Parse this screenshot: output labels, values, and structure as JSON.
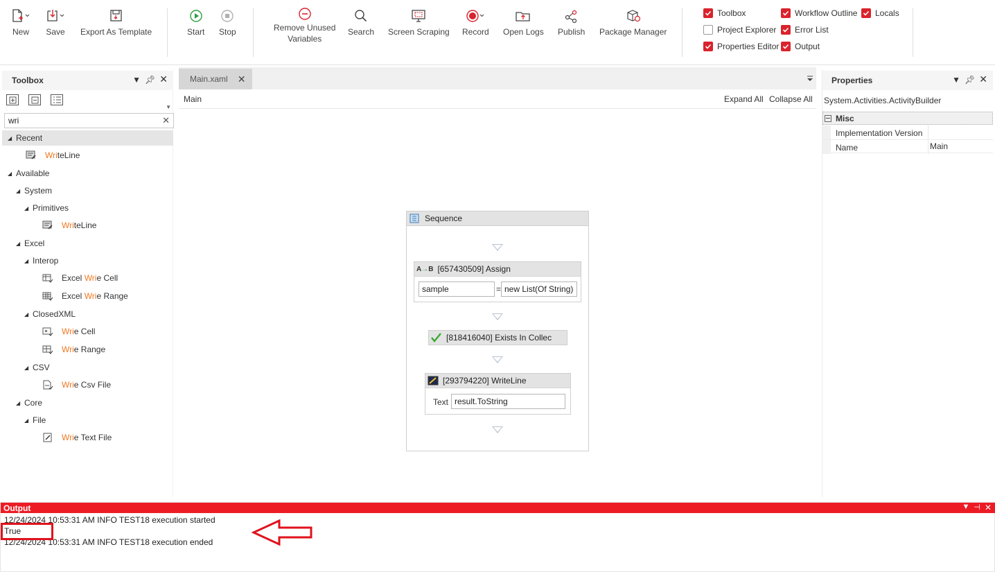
{
  "ribbon": {
    "buttons": {
      "new": "New",
      "save": "Save",
      "export_template": "Export As Template",
      "start": "Start",
      "stop": "Stop",
      "remove_unused_1": "Remove Unused",
      "remove_unused_2": "Variables",
      "search": "Search",
      "screen_scraping": "Screen Scraping",
      "record": "Record",
      "open_logs": "Open Logs",
      "publish": "Publish",
      "package_manager": "Package Manager"
    },
    "panels": {
      "toolbox": {
        "label": "Toolbox",
        "checked": true
      },
      "project_explorer": {
        "label": "Project Explorer",
        "checked": false
      },
      "properties_editor": {
        "label": "Properties Editor",
        "checked": true
      },
      "workflow_outline": {
        "label": "Workflow Outline",
        "checked": true
      },
      "error_list": {
        "label": "Error List",
        "checked": true
      },
      "output": {
        "label": "Output",
        "checked": true
      },
      "locals": {
        "label": "Locals",
        "checked": true
      }
    },
    "accent_color": "#d9232d"
  },
  "toolbox": {
    "title": "Toolbox",
    "search_value": "wri",
    "search_highlight": "Wri",
    "tree": {
      "recent": "Recent",
      "recent_writeline_rest": "teLine",
      "available": "Available",
      "system": "System",
      "primitives": "Primitives",
      "primitives_writeline_rest": "teLine",
      "excel": "Excel",
      "interop": "Interop",
      "excel_write_cell_pre": "Excel ",
      "excel_write_cell_post": "e Cell",
      "excel_write_range_pre": "Excel ",
      "excel_write_range_post": "e Range",
      "closedxml": "ClosedXML",
      "write_cell_post": "e Cell",
      "write_range_post": "e Range",
      "csv": "CSV",
      "write_csv_post": "e Csv File",
      "core": "Core",
      "file": "File",
      "write_text_post": "e Text File"
    },
    "highlight_color": "#f07820"
  },
  "designer": {
    "tab_label": "Main.xaml",
    "breadcrumb": "Main",
    "expand_all": "Expand All",
    "collapse_all": "Collapse All",
    "sequence": {
      "title": "Sequence",
      "assign": {
        "title": "[657430509] Assign",
        "left": "sample",
        "eq": "=",
        "right": "new List(Of String)"
      },
      "exists": {
        "title": "[818416040] Exists In Collec"
      },
      "writeline": {
        "title": "[293794220] WriteLine",
        "text_label": "Text",
        "text_value": "result.ToString"
      }
    }
  },
  "properties": {
    "title": "Properties",
    "type_name": "System.Activities.ActivityBuilder",
    "category": "Misc",
    "rows": [
      {
        "name": "Implementation Version",
        "value": ""
      },
      {
        "name": "Name",
        "value": "Main"
      }
    ]
  },
  "output": {
    "title": "Output",
    "header_color": "#ed1c24",
    "lines": [
      "12/24/2024 10:53:31 AM INFO TEST18 execution started",
      "True",
      "12/24/2024 10:53:31 AM INFO TEST18 execution ended"
    ]
  }
}
